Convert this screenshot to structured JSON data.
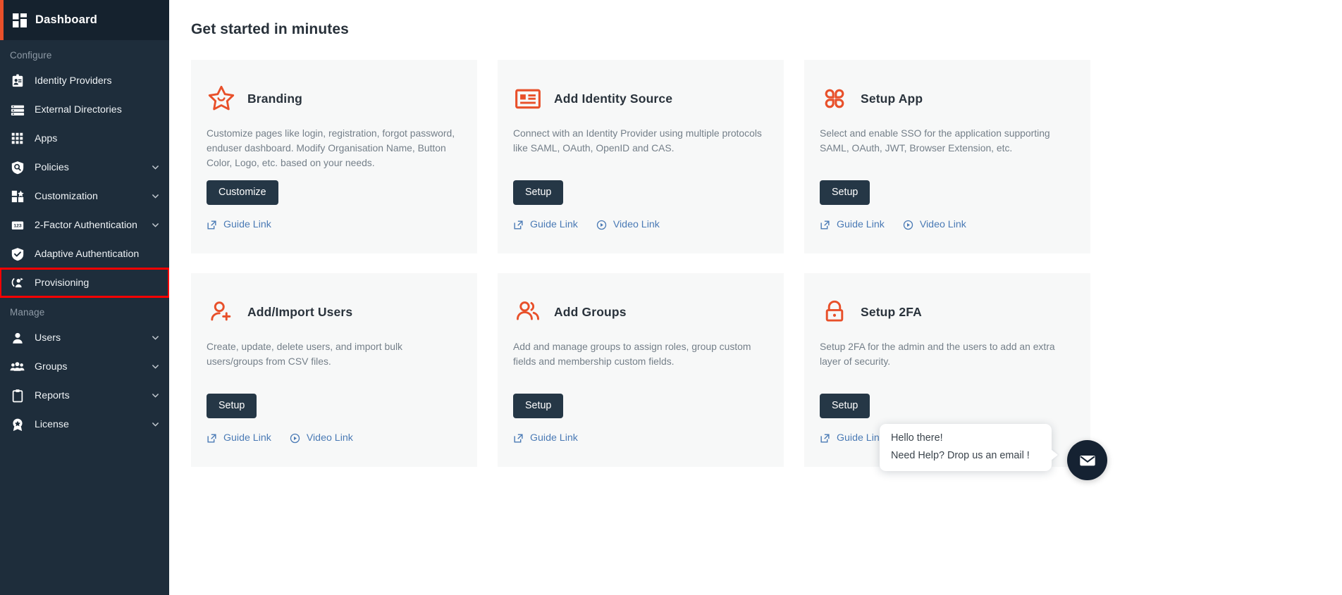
{
  "sidebar": {
    "header": {
      "title": "Dashboard",
      "icon": "dashboard-grid-icon"
    },
    "sections": [
      {
        "label": "Configure",
        "items": [
          {
            "label": "Identity Providers",
            "icon": "id-badge-icon",
            "chevron": false
          },
          {
            "label": "External Directories",
            "icon": "list-rows-icon",
            "chevron": false
          },
          {
            "label": "Apps",
            "icon": "grid-dots-icon",
            "chevron": false
          },
          {
            "label": "Policies",
            "icon": "shield-search-icon",
            "chevron": true
          },
          {
            "label": "Customization",
            "icon": "customization-icon",
            "chevron": true
          },
          {
            "label": "2-Factor Authentication",
            "icon": "numeric-123-icon",
            "chevron": true
          },
          {
            "label": "Adaptive Authentication",
            "icon": "shield-check-icon",
            "chevron": false
          },
          {
            "label": "Provisioning",
            "icon": "provisioning-icon",
            "chevron": false,
            "highlighted": true
          }
        ]
      },
      {
        "label": "Manage",
        "items": [
          {
            "label": "Users",
            "icon": "user-icon",
            "chevron": true
          },
          {
            "label": "Groups",
            "icon": "users-icon",
            "chevron": true
          },
          {
            "label": "Reports",
            "icon": "clipboard-icon",
            "chevron": true
          },
          {
            "label": "License",
            "icon": "badge-star-icon",
            "chevron": true
          }
        ]
      }
    ]
  },
  "main": {
    "page_title": "Get started in minutes",
    "cards": [
      {
        "title": "Branding",
        "icon": "star-smile-icon",
        "description": "Customize pages like login, registration, forgot password, enduser dashboard. Modify Organisation Name, Button Color, Logo, etc. based on your needs.",
        "button": "Customize",
        "links": [
          {
            "label": "Guide Link",
            "icon": "external-link-icon"
          }
        ]
      },
      {
        "title": "Add Identity Source",
        "icon": "id-card-icon",
        "description": "Connect with an Identity Provider using multiple protocols like SAML, OAuth, OpenID and CAS.",
        "button": "Setup",
        "links": [
          {
            "label": "Guide Link",
            "icon": "external-link-icon"
          },
          {
            "label": "Video Link",
            "icon": "play-circle-icon"
          }
        ]
      },
      {
        "title": "Setup App",
        "icon": "clover-apps-icon",
        "description": "Select and enable SSO for the application supporting SAML, OAuth, JWT, Browser Extension, etc.",
        "button": "Setup",
        "links": [
          {
            "label": "Guide Link",
            "icon": "external-link-icon"
          },
          {
            "label": "Video Link",
            "icon": "play-circle-icon"
          }
        ]
      },
      {
        "title": "Add/Import Users",
        "icon": "user-plus-icon",
        "description": "Create, update, delete users, and import bulk users/groups from CSV files.",
        "button": "Setup",
        "links": [
          {
            "label": "Guide Link",
            "icon": "external-link-icon"
          },
          {
            "label": "Video Link",
            "icon": "play-circle-icon"
          }
        ]
      },
      {
        "title": "Add Groups",
        "icon": "group-people-icon",
        "description": "Add and manage groups to assign roles, group custom fields and membership custom fields.",
        "button": "Setup",
        "links": [
          {
            "label": "Guide Link",
            "icon": "external-link-icon"
          }
        ]
      },
      {
        "title": "Setup 2FA",
        "icon": "padlock-icon",
        "description": "Setup 2FA for the admin and the users to add an extra layer of security.",
        "button": "Setup",
        "links": [
          {
            "label": "Guide Link",
            "icon": "external-link-icon"
          }
        ]
      }
    ]
  },
  "chat_widget": {
    "line1": "Hello there!",
    "line2": "Need Help? Drop us an email !",
    "fab_icon": "envelope-icon"
  },
  "colors": {
    "sidebar_bg": "#1e2d3b",
    "sidebar_header_bg": "#15222e",
    "accent_orange": "#e8502a",
    "button_dark": "#253746",
    "link_blue": "#4a7ab5",
    "highlight_red": "#fb0000",
    "card_bg": "#f7f8f8"
  }
}
